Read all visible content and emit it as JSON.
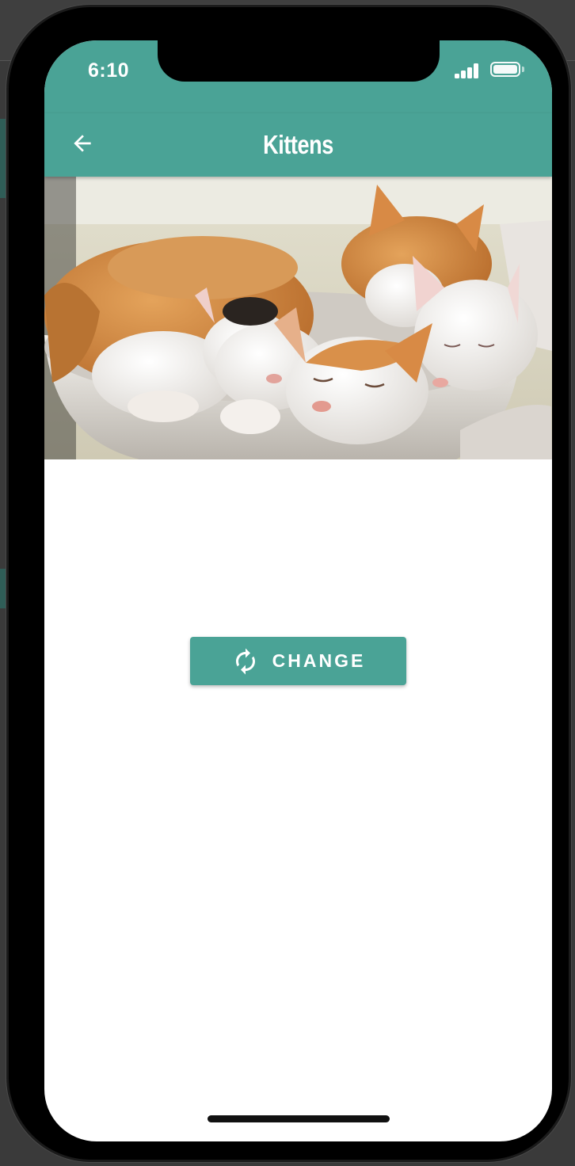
{
  "app_bar": {
    "title": "Kittens",
    "back_icon": "arrow-left-icon",
    "background_color": "#4aa396"
  },
  "status_bar": {
    "time": "6:10",
    "signal_icon": "cellular-signal-icon",
    "battery_icon": "battery-icon"
  },
  "photo": {
    "subject": "sleeping kittens in a bowl"
  },
  "action": {
    "change_label": "CHANGE",
    "change_icon": "refresh-icon"
  },
  "colors": {
    "accent": "#4aa396",
    "on_accent": "#ffffff"
  }
}
